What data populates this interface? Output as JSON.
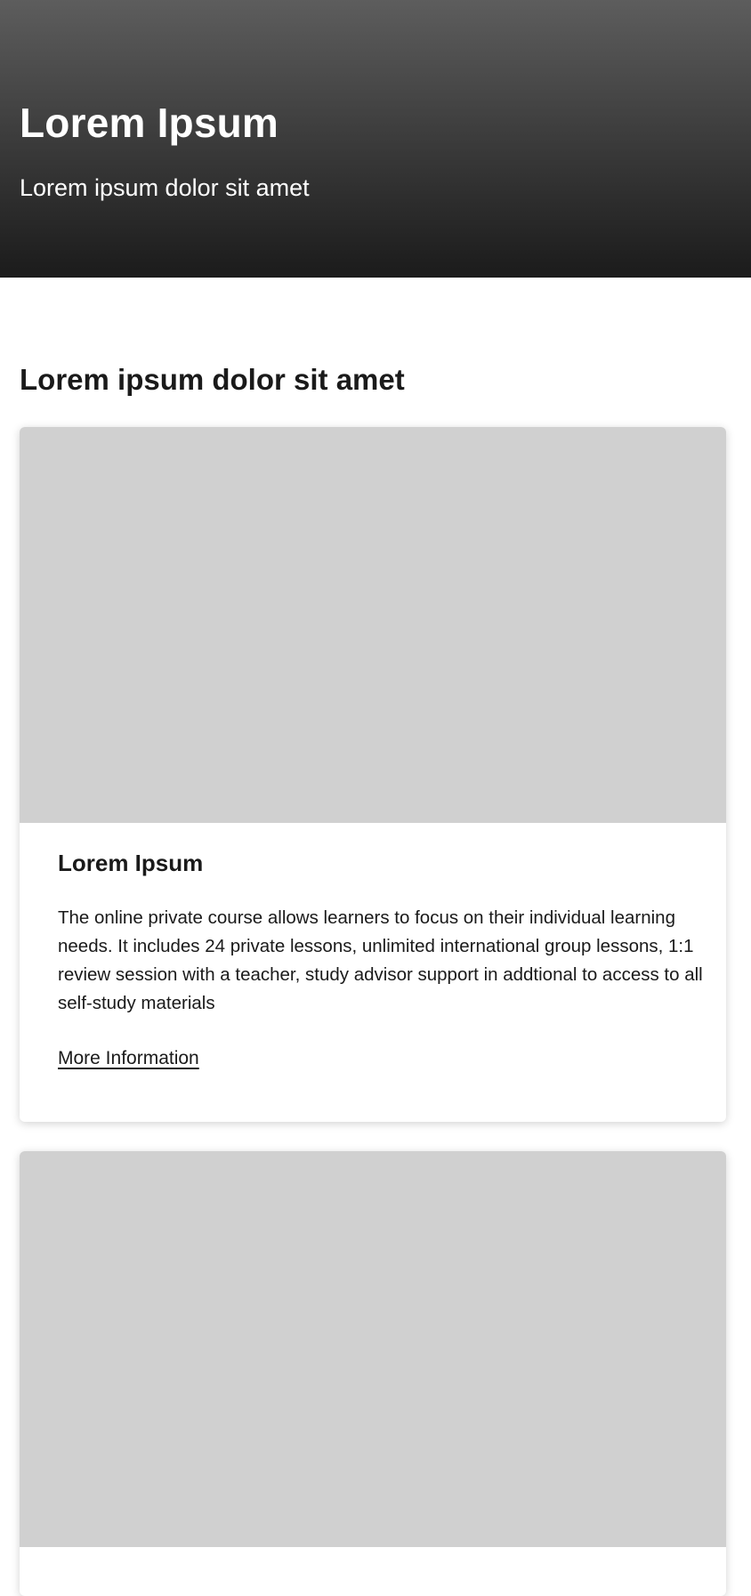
{
  "hero": {
    "title": "Lorem Ipsum",
    "subtitle": "Lorem ipsum dolor sit amet"
  },
  "section": {
    "heading": "Lorem ipsum dolor sit amet"
  },
  "cards": [
    {
      "title": "Lorem Ipsum",
      "body": "The online private course allows learners to focus on their individual learning needs. It includes 24 private lessons, unlimited international group lessons, 1:1 review session with a teacher, study advisor support in addtional to access to all self-study materials",
      "link_label": "More Information"
    }
  ],
  "colors": {
    "hero_gradient_top": "#5d5d5d",
    "hero_gradient_bottom": "#1b1b1b",
    "image_placeholder": "#d0d0d0",
    "text": "#1a1a1a"
  }
}
